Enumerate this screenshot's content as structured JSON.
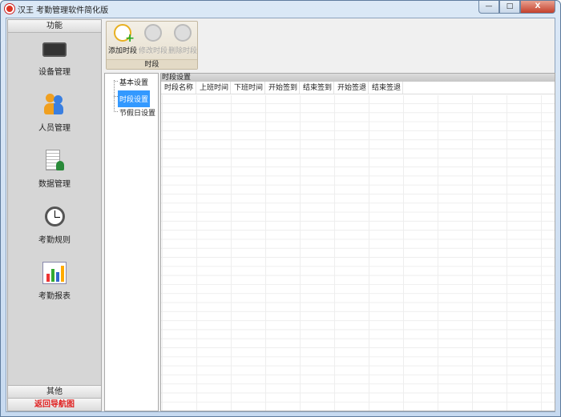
{
  "window": {
    "title": "汉王 考勤管理软件简化版",
    "minimize": "—",
    "maximize": "□",
    "close": "X"
  },
  "sidebar": {
    "header": "功能",
    "items": [
      {
        "label": "设备管理",
        "icon": "device-icon"
      },
      {
        "label": "人员管理",
        "icon": "users-icon"
      },
      {
        "label": "数据管理",
        "icon": "data-icon"
      },
      {
        "label": "考勤规则",
        "icon": "clock-icon"
      },
      {
        "label": "考勤报表",
        "icon": "chart-icon"
      }
    ],
    "other": "其他",
    "back": "返回导航图",
    "back_color": "#e02020"
  },
  "toolbar": {
    "buttons": [
      {
        "label": "添加时段",
        "enabled": true
      },
      {
        "label": "修改时段",
        "enabled": false
      },
      {
        "label": "删除时段",
        "enabled": false
      }
    ],
    "group": "时段"
  },
  "tree": {
    "items": [
      {
        "label": "基本设置",
        "selected": false
      },
      {
        "label": "时段设置",
        "selected": true
      },
      {
        "label": "节假日设置",
        "selected": false
      }
    ]
  },
  "grid": {
    "caption": "时段设置",
    "columns": [
      "时段名称",
      "上班时间",
      "下班时间",
      "开始签到",
      "结束签到",
      "开始签退",
      "结束签退"
    ],
    "rows": []
  }
}
